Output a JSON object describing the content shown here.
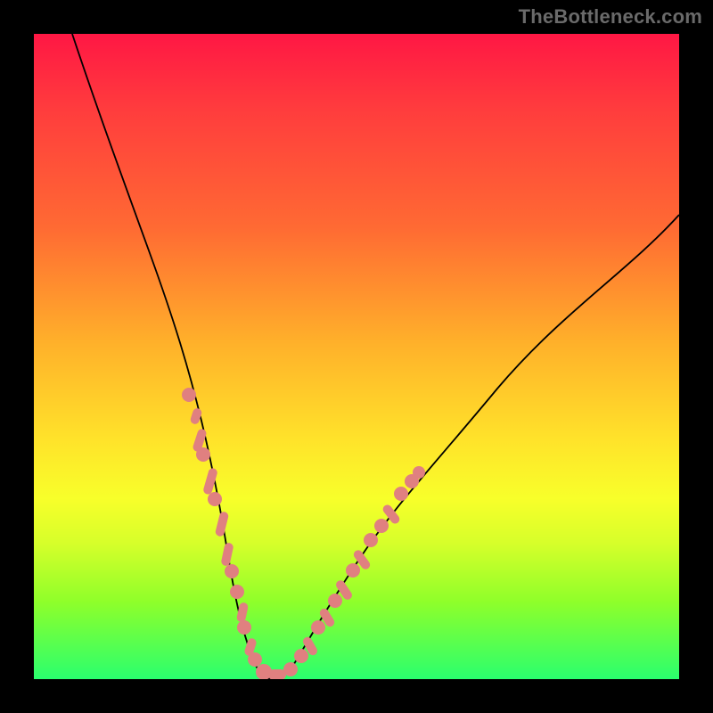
{
  "watermark": "TheBottleneck.com",
  "colors": {
    "gradient_top": "#ff1744",
    "gradient_mid1": "#ff6a33",
    "gradient_mid2": "#ffe32a",
    "gradient_bottom": "#2aff6e",
    "curve": "#000000",
    "marker": "#e08080",
    "frame": "#000000"
  },
  "chart_data": {
    "type": "line",
    "title": "",
    "xlabel": "",
    "ylabel": "",
    "xlim": [
      0,
      100
    ],
    "ylim": [
      0,
      100
    ],
    "grid": false,
    "legend": false,
    "series": [
      {
        "name": "bottleneck-curve",
        "x": [
          6,
          10,
          14,
          18,
          22,
          24,
          26,
          28,
          30,
          32,
          34,
          36,
          38,
          40,
          44,
          50,
          56,
          62,
          70,
          80,
          90,
          100
        ],
        "values": [
          100,
          88,
          77,
          66,
          52,
          44,
          36,
          26,
          16,
          8,
          3,
          0,
          0,
          2,
          9,
          22,
          33,
          42,
          52,
          61,
          67,
          72
        ]
      }
    ],
    "markers": [
      {
        "x": 24.0,
        "y": 44
      },
      {
        "x": 25.0,
        "y": 40
      },
      {
        "x": 25.7,
        "y": 37
      },
      {
        "x": 26.5,
        "y": 34
      },
      {
        "x": 27.4,
        "y": 30
      },
      {
        "x": 28.2,
        "y": 26
      },
      {
        "x": 29.2,
        "y": 21
      },
      {
        "x": 30.2,
        "y": 15
      },
      {
        "x": 31.0,
        "y": 10
      },
      {
        "x": 32.0,
        "y": 7
      },
      {
        "x": 33.0,
        "y": 4
      },
      {
        "x": 34.0,
        "y": 2
      },
      {
        "x": 35.0,
        "y": 1
      },
      {
        "x": 36.0,
        "y": 0
      },
      {
        "x": 37.0,
        "y": 0
      },
      {
        "x": 38.0,
        "y": 0
      },
      {
        "x": 39.0,
        "y": 1
      },
      {
        "x": 40.0,
        "y": 2
      },
      {
        "x": 41.5,
        "y": 5
      },
      {
        "x": 43.0,
        "y": 9
      },
      {
        "x": 44.5,
        "y": 13
      },
      {
        "x": 46.0,
        "y": 17
      },
      {
        "x": 47.5,
        "y": 21
      },
      {
        "x": 49.0,
        "y": 25
      },
      {
        "x": 50.5,
        "y": 28
      },
      {
        "x": 52.0,
        "y": 31
      },
      {
        "x": 53.5,
        "y": 34
      },
      {
        "x": 55.0,
        "y": 37
      }
    ]
  }
}
